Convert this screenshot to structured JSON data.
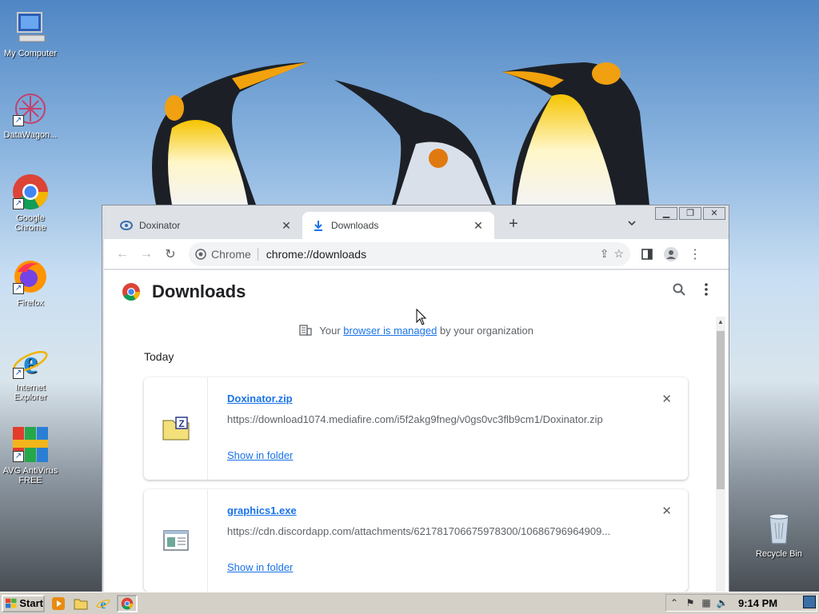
{
  "desktop": {
    "icons": [
      {
        "label": "My Computer",
        "icon": "computer-icon"
      },
      {
        "label": "DataWagon...",
        "icon": "datawagon-icon"
      },
      {
        "label": "Google Chrome",
        "icon": "chrome-icon"
      },
      {
        "label": "Firefox",
        "icon": "firefox-icon"
      },
      {
        "label": "Internet Explorer",
        "icon": "ie-icon"
      },
      {
        "label": "AVG AntiVirus FREE",
        "icon": "avg-icon"
      },
      {
        "label": "Recycle Bin",
        "icon": "recycle-bin-icon"
      }
    ]
  },
  "browser": {
    "window_controls": {
      "minimize": "▁",
      "restore": "❐",
      "close": "✕"
    },
    "tabs": [
      {
        "title": "Doxinator",
        "icon": "doxinator-favicon",
        "active": false
      },
      {
        "title": "Downloads",
        "icon": "download-icon",
        "active": true
      }
    ],
    "new_tab": "+",
    "tab_search": "⌄",
    "toolbar": {
      "back": "←",
      "forward": "→",
      "reload": "↻",
      "chip_label": "Chrome",
      "url": "chrome://downloads",
      "share": "⇪",
      "bookmark": "☆",
      "side_panel": "▮",
      "menu": "⋮"
    }
  },
  "downloads_page": {
    "title": "Downloads",
    "managed_prefix": "Your ",
    "managed_link": "browser is managed",
    "managed_suffix": " by your organization",
    "section_date": "Today",
    "items": [
      {
        "file_name": "Doxinator.zip",
        "url": "https://download1074.mediafire.com/i5f2akg9fneg/v0gs0vc3flb9cm1/Doxinator.zip",
        "action": "Show in folder",
        "remove": "✕",
        "icon": "zip-file-icon"
      },
      {
        "file_name": "graphics1.exe",
        "url": "https://cdn.discordapp.com/attachments/621781706675978300/10686796964909...",
        "action": "Show in folder",
        "remove": "✕",
        "icon": "exe-file-icon"
      }
    ]
  },
  "taskbar": {
    "start_label": "Start",
    "clock": "9:14 PM",
    "tray_expand": "⌃"
  },
  "colors": {
    "link": "#1a73e8",
    "tab_strip": "#dee1e6",
    "taskbar": "#d4d0c8"
  }
}
